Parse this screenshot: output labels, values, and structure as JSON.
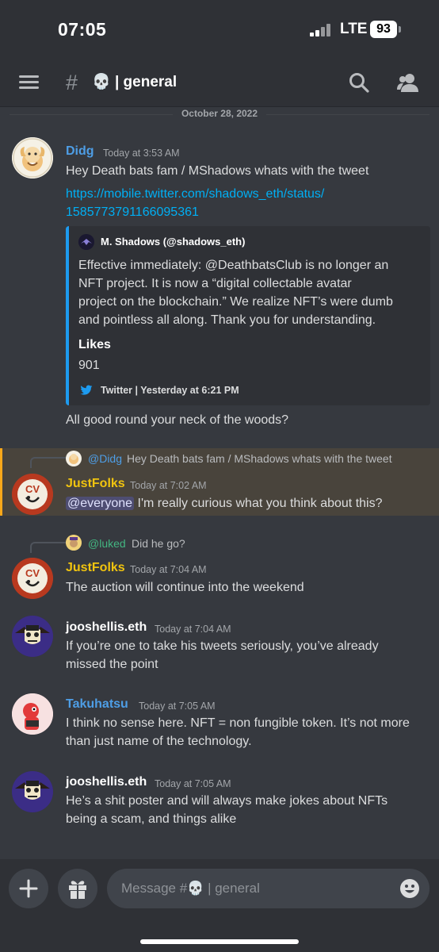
{
  "status_bar": {
    "time": "07:05",
    "network": "LTE",
    "battery": "93"
  },
  "header": {
    "hash": "#",
    "channel_emoji": "💀",
    "channel_name": "| general"
  },
  "date_divider": "October 28, 2022",
  "messages": [
    {
      "author": "Didg",
      "time": "Today at 3:53 AM",
      "text": "Hey Death bats fam / MShadows whats with the tweet",
      "link_line1": "https://mobile.twitter.com/shadows_eth/status/",
      "link_line2": "1585773791166095361",
      "embed": {
        "author": "M. Shadows (@shadows_eth)",
        "desc_lines": [
          "Effective immediately: @DeathbatsClub is no longer an",
          "NFT project.  It is now a “digital collectable avatar",
          "project on the blockchain.”  We realize NFT’s were dumb",
          "and pointless all along.  Thank you for understanding."
        ],
        "field_name": "Likes",
        "field_value": "901",
        "footer": "Twitter | Yesterday at 6:21 PM"
      },
      "followup": "All good round your neck of the woods?"
    },
    {
      "reply_name": "@Didg",
      "reply_text": "Hey Death bats fam / MShadows whats with the tweet",
      "author": "JustFolks",
      "time": "Today at 7:02 AM",
      "mention": "@everyone",
      "text": " I'm really curious what you think about this?"
    },
    {
      "reply_name": "@luked",
      "reply_text": "Did he go?",
      "author": "JustFolks",
      "time": "Today at 7:04 AM",
      "text": "The auction will continue into the weekend"
    },
    {
      "author": "jooshellis.eth",
      "time": "Today at 7:04 AM",
      "line1": "If you’re one to take his tweets seriously, you’ve already",
      "line2": "missed the point"
    },
    {
      "author": "Takuhatsu",
      "time": "Today at 7:05 AM",
      "line1": "I think no sense here. NFT = non fungible token. It’s not more",
      "line2": "than just name of the technology."
    },
    {
      "author": "jooshellis.eth",
      "time": "Today at 7:05 AM",
      "line1": "He’s a shit poster and will always make jokes about NFTs",
      "line2": "being a scam, and things alike"
    }
  ],
  "composer": {
    "placeholder_prefix": "Message #",
    "placeholder_emoji": "💀",
    "placeholder_channel": " | general"
  },
  "colors": {
    "background": "#36393f",
    "link": "#00aff4",
    "twitter": "#1d9bf0",
    "mention_highlight": "#faa81a",
    "didg_name": "#4e9ee6",
    "justfolks_name": "#f1c40f",
    "jooshellis_name": "#ffffff",
    "takuhatsu_name": "#4e9ee6",
    "luked_name": "#43b581"
  }
}
